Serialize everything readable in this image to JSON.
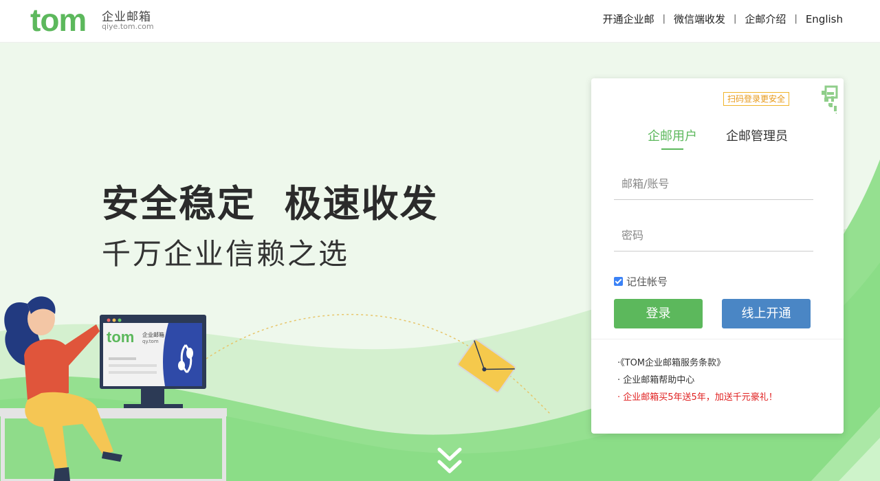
{
  "header": {
    "logo_text": "tom",
    "logo_cn": "企业邮箱",
    "logo_url": "qiye.tom.com",
    "nav": [
      "开通企业邮",
      "微信端收发",
      "企邮介绍",
      "English"
    ],
    "separator": "|"
  },
  "hero": {
    "headline": "安全稳定  极速收发",
    "subline": "千万企业信赖之选",
    "monitor_logo": "tom",
    "monitor_cn": "企业邮箱",
    "monitor_url": "qy.tom"
  },
  "login": {
    "qr_tip": "扫码登录更安全",
    "tab_user": "企邮用户",
    "tab_admin": "企邮管理员",
    "account_placeholder": "邮箱/账号",
    "password_placeholder": "密码",
    "remember_label": "记住帐号",
    "remember_checked": true,
    "login_button": "登录",
    "open_button": "线上开通",
    "links": [
      "·《TOM企业邮箱服务条款》",
      "· 企业邮箱帮助中心",
      "· 企业邮箱买5年送5年，加送千元豪礼！"
    ]
  },
  "colors": {
    "brand_green": "#5cb85c",
    "button_blue": "#4a86c5",
    "promo_red": "#e02020",
    "tip_orange": "#e79a1b"
  }
}
